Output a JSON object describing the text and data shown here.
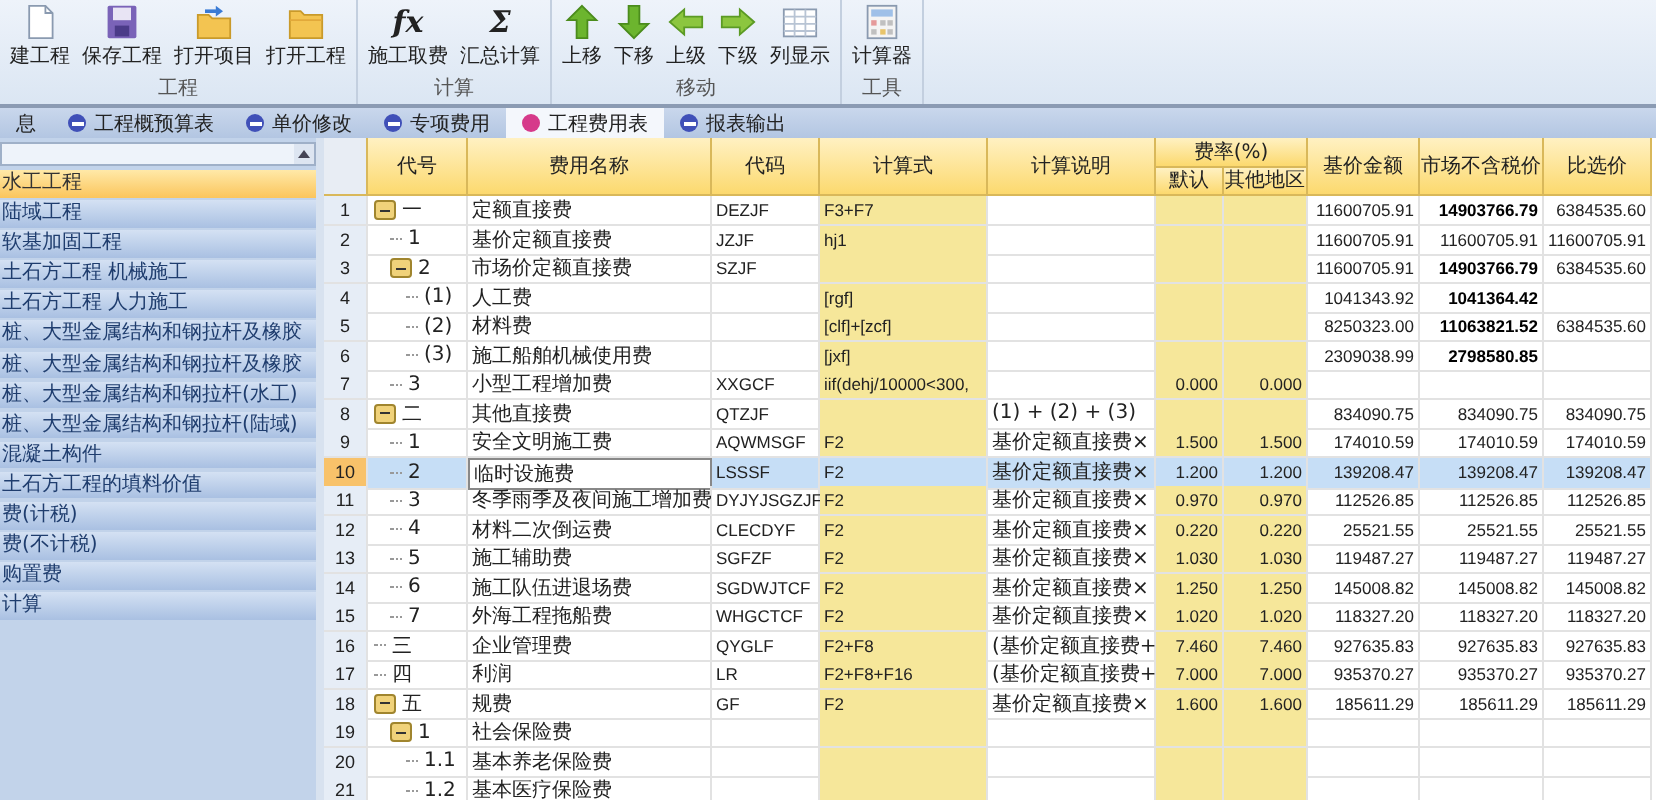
{
  "ribbon": {
    "groups": [
      {
        "label": "工程",
        "buttons": [
          {
            "label": "建工程",
            "kind": "new"
          },
          {
            "label": "保存工程",
            "kind": "save"
          },
          {
            "label": "打开项目",
            "kind": "import"
          },
          {
            "label": "打开工程",
            "kind": "open"
          }
        ]
      },
      {
        "label": "计算",
        "buttons": [
          {
            "label": "施工取费",
            "kind": "glyph",
            "glyph": "fx"
          },
          {
            "label": "汇总计算",
            "kind": "glyph",
            "glyph": "Σ"
          }
        ]
      },
      {
        "label": "移动",
        "buttons": [
          {
            "label": "上移",
            "kind": "up"
          },
          {
            "label": "下移",
            "kind": "down"
          },
          {
            "label": "上级",
            "kind": "left"
          },
          {
            "label": "下级",
            "kind": "right"
          },
          {
            "label": "列显示",
            "kind": "grid"
          }
        ]
      },
      {
        "label": "工具",
        "buttons": [
          {
            "label": "计算器",
            "kind": "calculator"
          }
        ]
      }
    ]
  },
  "tabs": [
    {
      "label": "息",
      "selected": false,
      "icon": false
    },
    {
      "label": "工程概预算表",
      "selected": false,
      "icon": true
    },
    {
      "label": "单价修改",
      "selected": false,
      "icon": true
    },
    {
      "label": "专项费用",
      "selected": false,
      "icon": true
    },
    {
      "label": "工程费用表",
      "selected": true,
      "icon": true
    },
    {
      "label": "报表输出",
      "selected": false,
      "icon": true
    }
  ],
  "sidebar": {
    "items": [
      {
        "label": "水工工程",
        "selected": true
      },
      {
        "label": "陆域工程",
        "selected": false
      },
      {
        "label": "软基加固工程",
        "selected": false
      },
      {
        "label": "土石方工程 机械施工",
        "selected": false
      },
      {
        "label": "土石方工程 人力施工",
        "selected": false
      },
      {
        "label": "桩、大型金属结构和钢拉杆及橡胶",
        "selected": false
      },
      {
        "label": "桩、大型金属结构和钢拉杆及橡胶",
        "selected": false
      },
      {
        "label": "桩、大型金属结构和钢拉杆(水工)",
        "selected": false
      },
      {
        "label": "桩、大型金属结构和钢拉杆(陆域)",
        "selected": false
      },
      {
        "label": "混凝土构件",
        "selected": false
      },
      {
        "label": "土石方工程的填料价值",
        "selected": false
      },
      {
        "label": "费(计税)",
        "selected": false
      },
      {
        "label": "费(不计税)",
        "selected": false
      },
      {
        "label": "购置费",
        "selected": false
      },
      {
        "label": "计算",
        "selected": false
      }
    ]
  },
  "table": {
    "columns": {
      "code": "代号",
      "name": "费用名称",
      "abbr": "代码",
      "formula": "计算式",
      "note": "计算说明",
      "rate_group": "费率(%)",
      "rate": "默认",
      "rate_other": "其他地区",
      "base_amount": "基价金额",
      "market_price": "市场不含税价",
      "compare_price": "比选价"
    },
    "rows": [
      {
        "no": "1",
        "code": "一",
        "name": "定额直接费",
        "abbr": "DEZJF",
        "formula": "F3+F7",
        "base_amount": "11600705.91",
        "market_price": "14903766.79",
        "compare_price": "6384535.60",
        "market_bold": true,
        "selected": false,
        "expanded": true,
        "children": [
          {
            "no": "2",
            "code": "1",
            "name": "基价定额直接费",
            "abbr": "JZJF",
            "formula": "hj1",
            "base_amount": "11600705.91",
            "market_price": "11600705.91",
            "compare_price": "11600705.91",
            "market_bold": false,
            "selected": false
          },
          {
            "no": "3",
            "code": "2",
            "name": "市场价定额直接费",
            "abbr": "SZJF",
            "base_amount": "11600705.91",
            "market_price": "14903766.79",
            "compare_price": "6384535.60",
            "market_bold": true,
            "selected": false,
            "expanded": true,
            "children": [
              {
                "no": "4",
                "code": "(1)",
                "name": "人工费",
                "formula": "[rgf]",
                "base_amount": "1041343.92",
                "market_price": "1041364.42",
                "market_bold": true,
                "selected": false
              },
              {
                "no": "5",
                "code": "(2)",
                "name": "材料费",
                "formula": "[clf]+[zcf]",
                "base_amount": "8250323.00",
                "market_price": "11063821.52",
                "compare_price": "6384535.60",
                "market_bold": true,
                "selected": false
              },
              {
                "no": "6",
                "code": "(3)",
                "name": "施工船舶机械使用费",
                "formula": "[jxf]",
                "base_amount": "2309038.99",
                "market_price": "2798580.85",
                "market_bold": true,
                "selected": false
              }
            ]
          },
          {
            "no": "7",
            "code": "3",
            "name": "小型工程增加费",
            "abbr": "XXGCF",
            "formula": "iif(dehj/10000<300,",
            "rate": "0.000",
            "rate_other": "0.000",
            "selected": false
          }
        ]
      },
      {
        "no": "8",
        "code": "二",
        "name": "其他直接费",
        "abbr": "QTZJF",
        "note": "(1) + (2) + (3)",
        "base_amount": "834090.75",
        "market_price": "834090.75",
        "compare_price": "834090.75",
        "market_bold": false,
        "selected": false,
        "expanded": true,
        "children": [
          {
            "no": "9",
            "code": "1",
            "name": "安全文明施工费",
            "abbr": "AQWMSGF",
            "formula": "F2",
            "note": "基价定额直接费×",
            "rate": "1.500",
            "rate_other": "1.500",
            "base_amount": "174010.59",
            "market_price": "174010.59",
            "compare_price": "174010.59",
            "market_bold": false,
            "selected": false
          },
          {
            "no": "10",
            "code": "2",
            "name": "临时设施费",
            "abbr": "LSSSF",
            "formula": "F2",
            "note": "基价定额直接费×",
            "rate": "1.200",
            "rate_other": "1.200",
            "base_amount": "139208.47",
            "market_price": "139208.47",
            "compare_price": "139208.47",
            "market_bold": false,
            "selected": true
          },
          {
            "no": "11",
            "code": "3",
            "name": "冬季雨季及夜间施工增加费",
            "abbr": "DYJYJSGZJF",
            "formula": "F2",
            "note": "基价定额直接费×",
            "rate": "0.970",
            "rate_other": "0.970",
            "base_amount": "112526.85",
            "market_price": "112526.85",
            "compare_price": "112526.85",
            "market_bold": false,
            "selected": false
          },
          {
            "no": "12",
            "code": "4",
            "name": "材料二次倒运费",
            "abbr": "CLECDYF",
            "formula": "F2",
            "note": "基价定额直接费×",
            "rate": "0.220",
            "rate_other": "0.220",
            "base_amount": "25521.55",
            "market_price": "25521.55",
            "compare_price": "25521.55",
            "market_bold": false,
            "selected": false
          },
          {
            "no": "13",
            "code": "5",
            "name": "施工辅助费",
            "abbr": "SGFZF",
            "formula": "F2",
            "note": "基价定额直接费×",
            "rate": "1.030",
            "rate_other": "1.030",
            "base_amount": "119487.27",
            "market_price": "119487.27",
            "compare_price": "119487.27",
            "market_bold": false,
            "selected": false
          },
          {
            "no": "14",
            "code": "6",
            "name": "施工队伍进退场费",
            "abbr": "SGDWJTCF",
            "formula": "F2",
            "note": "基价定额直接费×",
            "rate": "1.250",
            "rate_other": "1.250",
            "base_amount": "145008.82",
            "market_price": "145008.82",
            "compare_price": "145008.82",
            "market_bold": false,
            "selected": false
          },
          {
            "no": "15",
            "code": "7",
            "name": "外海工程拖船费",
            "abbr": "WHGCTCF",
            "formula": "F2",
            "note": "基价定额直接费×",
            "rate": "1.020",
            "rate_other": "1.020",
            "base_amount": "118327.20",
            "market_price": "118327.20",
            "compare_price": "118327.20",
            "market_bold": false,
            "selected": false
          }
        ]
      },
      {
        "no": "16",
        "code": "三",
        "name": "企业管理费",
        "abbr": "QYGLF",
        "formula": "F2+F8",
        "note": "(基价定额直接费+",
        "rate": "7.460",
        "rate_other": "7.460",
        "base_amount": "927635.83",
        "market_price": "927635.83",
        "compare_price": "927635.83",
        "market_bold": false,
        "selected": false
      },
      {
        "no": "17",
        "code": "四",
        "name": "利润",
        "abbr": "LR",
        "formula": "F2+F8+F16",
        "note": "(基价定额直接费+",
        "rate": "7.000",
        "rate_other": "7.000",
        "base_amount": "935370.27",
        "market_price": "935370.27",
        "compare_price": "935370.27",
        "market_bold": false,
        "selected": false
      },
      {
        "no": "18",
        "code": "五",
        "name": "规费",
        "abbr": "GF",
        "formula": "F2",
        "note": "基价定额直接费×",
        "rate": "1.600",
        "rate_other": "1.600",
        "base_amount": "185611.29",
        "market_price": "185611.29",
        "compare_price": "185611.29",
        "market_bold": false,
        "selected": false,
        "expanded": true,
        "children": [
          {
            "no": "19",
            "code": "1",
            "name": "社会保险费",
            "selected": false,
            "expanded": true,
            "children": [
              {
                "no": "20",
                "code": "1.1",
                "name": "基本养老保险费",
                "selected": false
              },
              {
                "no": "21",
                "code": "1.2",
                "name": "基本医疗保险费",
                "selected": false
              }
            ]
          }
        ]
      }
    ]
  }
}
